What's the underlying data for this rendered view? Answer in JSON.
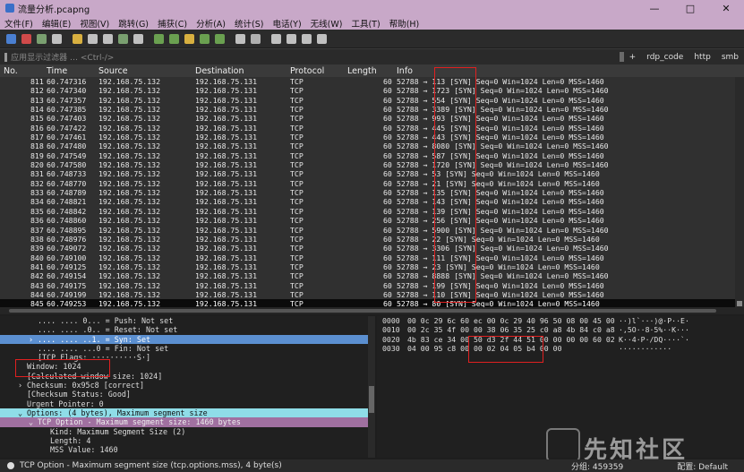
{
  "window": {
    "title": "流量分析.pcapng",
    "min": "—",
    "max": "□",
    "close": "✕"
  },
  "menu": [
    "文件(F)",
    "编辑(E)",
    "视图(V)",
    "跳转(G)",
    "捕获(C)",
    "分析(A)",
    "统计(S)",
    "电话(Y)",
    "无线(W)",
    "工具(T)",
    "帮助(H)"
  ],
  "toolbar_icons": [
    "shark-fin-icon",
    "stop-icon",
    "restart-icon",
    "options-icon",
    "open-icon",
    "save-icon",
    "close-file-icon",
    "reload-icon",
    "find-icon",
    "back-icon",
    "forward-icon",
    "goto-icon",
    "first-icon",
    "last-icon",
    "autoscroll-icon",
    "colorize-icon",
    "zoom-in-icon",
    "zoom-out-icon",
    "zoom-reset-icon",
    "resize-columns-icon"
  ],
  "filter": {
    "placeholder": "应用显示过滤器 … <Ctrl-/>",
    "buttons": [
      "+",
      "rdp_code",
      "http",
      "smb"
    ]
  },
  "columns": [
    "No.",
    "Time",
    "Source",
    "Destination",
    "Protocol",
    "Length",
    "Info"
  ],
  "packets": [
    [
      "811",
      "60.747316",
      "192.168.75.132",
      "192.168.75.131",
      "TCP",
      "60",
      "52788 → 113 [SYN] Seq=0 Win=1024 Len=0 MSS=1460"
    ],
    [
      "812",
      "60.747340",
      "192.168.75.132",
      "192.168.75.131",
      "TCP",
      "60",
      "52788 → 1723 [SYN] Seq=0 Win=1024 Len=0 MSS=1460"
    ],
    [
      "813",
      "60.747357",
      "192.168.75.132",
      "192.168.75.131",
      "TCP",
      "60",
      "52788 → 554 [SYN] Seq=0 Win=1024 Len=0 MSS=1460"
    ],
    [
      "814",
      "60.747385",
      "192.168.75.132",
      "192.168.75.131",
      "TCP",
      "60",
      "52788 → 3389 [SYN] Seq=0 Win=1024 Len=0 MSS=1460"
    ],
    [
      "815",
      "60.747403",
      "192.168.75.132",
      "192.168.75.131",
      "TCP",
      "60",
      "52788 → 993 [SYN] Seq=0 Win=1024 Len=0 MSS=1460"
    ],
    [
      "816",
      "60.747422",
      "192.168.75.132",
      "192.168.75.131",
      "TCP",
      "60",
      "52788 → 445 [SYN] Seq=0 Win=1024 Len=0 MSS=1460"
    ],
    [
      "817",
      "60.747461",
      "192.168.75.132",
      "192.168.75.131",
      "TCP",
      "60",
      "52788 → 443 [SYN] Seq=0 Win=1024 Len=0 MSS=1460"
    ],
    [
      "818",
      "60.747480",
      "192.168.75.132",
      "192.168.75.131",
      "TCP",
      "60",
      "52788 → 8080 [SYN] Seq=0 Win=1024 Len=0 MSS=1460"
    ],
    [
      "819",
      "60.747549",
      "192.168.75.132",
      "192.168.75.131",
      "TCP",
      "60",
      "52788 → 587 [SYN] Seq=0 Win=1024 Len=0 MSS=1460"
    ],
    [
      "820",
      "60.747580",
      "192.168.75.132",
      "192.168.75.131",
      "TCP",
      "60",
      "52788 → 1720 [SYN] Seq=0 Win=1024 Len=0 MSS=1460"
    ],
    [
      "831",
      "60.748733",
      "192.168.75.132",
      "192.168.75.131",
      "TCP",
      "60",
      "52788 → 53 [SYN] Seq=0 Win=1024 Len=0 MSS=1460"
    ],
    [
      "832",
      "60.748770",
      "192.168.75.132",
      "192.168.75.131",
      "TCP",
      "60",
      "52788 → 21 [SYN] Seq=0 Win=1024 Len=0 MSS=1460"
    ],
    [
      "833",
      "60.748789",
      "192.168.75.132",
      "192.168.75.131",
      "TCP",
      "60",
      "52788 → 135 [SYN] Seq=0 Win=1024 Len=0 MSS=1460"
    ],
    [
      "834",
      "60.748821",
      "192.168.75.132",
      "192.168.75.131",
      "TCP",
      "60",
      "52788 → 143 [SYN] Seq=0 Win=1024 Len=0 MSS=1460"
    ],
    [
      "835",
      "60.748842",
      "192.168.75.132",
      "192.168.75.131",
      "TCP",
      "60",
      "52788 → 139 [SYN] Seq=0 Win=1024 Len=0 MSS=1460"
    ],
    [
      "836",
      "60.748860",
      "192.168.75.132",
      "192.168.75.131",
      "TCP",
      "60",
      "52788 → 256 [SYN] Seq=0 Win=1024 Len=0 MSS=1460"
    ],
    [
      "837",
      "60.748895",
      "192.168.75.132",
      "192.168.75.131",
      "TCP",
      "60",
      "52788 → 5900 [SYN] Seq=0 Win=1024 Len=0 MSS=1460"
    ],
    [
      "838",
      "60.748976",
      "192.168.75.132",
      "192.168.75.131",
      "TCP",
      "60",
      "52788 → 22 [SYN] Seq=0 Win=1024 Len=0 MSS=1460"
    ],
    [
      "839",
      "60.749072",
      "192.168.75.132",
      "192.168.75.131",
      "TCP",
      "60",
      "52788 → 3306 [SYN] Seq=0 Win=1024 Len=0 MSS=1460"
    ],
    [
      "840",
      "60.749100",
      "192.168.75.132",
      "192.168.75.131",
      "TCP",
      "60",
      "52788 → 111 [SYN] Seq=0 Win=1024 Len=0 MSS=1460"
    ],
    [
      "841",
      "60.749125",
      "192.168.75.132",
      "192.168.75.131",
      "TCP",
      "60",
      "52788 → 23 [SYN] Seq=0 Win=1024 Len=0 MSS=1460"
    ],
    [
      "842",
      "60.749154",
      "192.168.75.132",
      "192.168.75.131",
      "TCP",
      "60",
      "52788 → 8888 [SYN] Seq=0 Win=1024 Len=0 MSS=1460"
    ],
    [
      "843",
      "60.749175",
      "192.168.75.132",
      "192.168.75.131",
      "TCP",
      "60",
      "52788 → 199 [SYN] Seq=0 Win=1024 Len=0 MSS=1460"
    ],
    [
      "844",
      "60.749199",
      "192.168.75.132",
      "192.168.75.131",
      "TCP",
      "60",
      "52788 → 110 [SYN] Seq=0 Win=1024 Len=0 MSS=1460"
    ],
    [
      "845",
      "60.749253",
      "192.168.75.132",
      "192.168.75.131",
      "TCP",
      "60",
      "52788 → 80 [SYN] Seq=0 Win=1024 Len=0 MSS=1460"
    ]
  ],
  "selected_packet_index": 24,
  "details": [
    {
      "text": ".... .... 0... = Push: Not set",
      "indent": 42,
      "arrow": "",
      "style": ""
    },
    {
      "text": ".... .... .0.. = Reset: Not set",
      "indent": 42,
      "arrow": "",
      "style": ""
    },
    {
      "text": ".... .... ..1. = Syn: Set",
      "indent": 42,
      "arrow": "›",
      "style": "hl1"
    },
    {
      "text": ".... .... ...0 = Fin: Not set",
      "indent": 42,
      "arrow": "",
      "style": ""
    },
    {
      "text": "[TCP Flags: ··········S·]",
      "indent": 42,
      "arrow": "",
      "style": ""
    },
    {
      "text": "Window: 1024",
      "indent": 30,
      "arrow": "",
      "style": ""
    },
    {
      "text": "[Calculated window size: 1024]",
      "indent": 30,
      "arrow": "",
      "style": ""
    },
    {
      "text": "Checksum: 0x95c8 [correct]",
      "indent": 30,
      "arrow": "›",
      "style": ""
    },
    {
      "text": "[Checksum Status: Good]",
      "indent": 30,
      "arrow": "",
      "style": ""
    },
    {
      "text": "Urgent Pointer: 0",
      "indent": 30,
      "arrow": "",
      "style": ""
    },
    {
      "text": "Options: (4 bytes), Maximum segment size",
      "indent": 30,
      "arrow": "⌄",
      "style": "hl2"
    },
    {
      "text": "TCP Option - Maximum segment size: 1460 bytes",
      "indent": 42,
      "arrow": "⌄",
      "style": "hl3"
    },
    {
      "text": "Kind: Maximum Segment Size (2)",
      "indent": 56,
      "arrow": "",
      "style": ""
    },
    {
      "text": "Length: 4",
      "indent": 56,
      "arrow": "",
      "style": ""
    },
    {
      "text": "MSS Value: 1460",
      "indent": 56,
      "arrow": "",
      "style": ""
    }
  ],
  "hex": [
    {
      "off": "0000",
      "bytes": "00 0c 29 6c 60 ec 00 0c  29 40 96 50 08 00 45 00",
      "ascii": "··)l`···)@·P··E·"
    },
    {
      "off": "0010",
      "bytes": "00 2c 35 4f 00 00 38 06  35 25 c0 a8 4b 84 c0 a8",
      "ascii": "·,5O··8·5%··K···"
    },
    {
      "off": "0020",
      "bytes": "4b 83 ce 34 00 50 d3 2f  44 51 00 00 00 00 60 02",
      "ascii": "K··4·P·/DQ····`·"
    },
    {
      "off": "0030",
      "bytes": "04 00 95 c8 00 00 02 04  05 b4 00 00",
      "ascii": "············"
    }
  ],
  "status": {
    "text": "TCP Option - Maximum segment size (tcp.options.mss), 4 byte(s)",
    "packets": "分组: 459359",
    "profile": "配置: Default"
  },
  "watermark": "先知社区"
}
